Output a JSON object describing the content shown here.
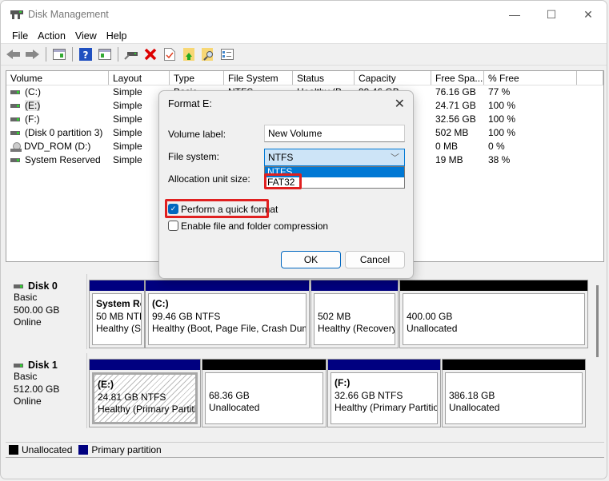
{
  "window": {
    "title": "Disk Management",
    "controls": {
      "minimize": "—",
      "maximize": "☐",
      "close": "✕"
    }
  },
  "menu": [
    "File",
    "Action",
    "View",
    "Help"
  ],
  "toolbar": [
    {
      "icon": "back-arrow-icon"
    },
    {
      "icon": "forward-arrow-icon"
    },
    {
      "icon": "show-hide-console-tree-icon"
    },
    {
      "icon": "help-icon"
    },
    {
      "icon": "show-hide-action-pane-icon"
    },
    {
      "icon": "connect-virtual-disk-icon"
    },
    {
      "icon": "delete-icon"
    },
    {
      "icon": "properties-icon"
    },
    {
      "icon": "export-list-icon"
    },
    {
      "icon": "search-icon"
    },
    {
      "icon": "settings-list-icon"
    }
  ],
  "volume_table": {
    "columns": [
      "Volume",
      "Layout",
      "Type",
      "File System",
      "Status",
      "Capacity",
      "Free Spa...",
      "% Free"
    ],
    "rows": [
      {
        "volume": "(C:)",
        "layout": "Simple",
        "type": "Basic",
        "fs": "NTFS",
        "status": "Healthy (B...",
        "capacity": "99.46 GB",
        "free": "76.16 GB",
        "pct": "77 %",
        "icon": "drive"
      },
      {
        "volume": "(E:)",
        "layout": "Simple",
        "type": "",
        "fs": "",
        "status": "",
        "capacity": "",
        "free": "24.71 GB",
        "pct": "100 %",
        "icon": "drive"
      },
      {
        "volume": "(F:)",
        "layout": "Simple",
        "type": "",
        "fs": "",
        "status": "",
        "capacity": "",
        "free": "32.56 GB",
        "pct": "100 %",
        "icon": "drive"
      },
      {
        "volume": "(Disk 0 partition 3)",
        "layout": "Simple",
        "type": "",
        "fs": "",
        "status": "",
        "capacity": "",
        "free": "502 MB",
        "pct": "100 %",
        "icon": "drive"
      },
      {
        "volume": "DVD_ROM (D:)",
        "layout": "Simple",
        "type": "",
        "fs": "",
        "status": "",
        "capacity": "",
        "free": "0 MB",
        "pct": "0 %",
        "icon": "dvd"
      },
      {
        "volume": "System Reserved",
        "layout": "Simple",
        "type": "",
        "fs": "",
        "status": "",
        "capacity": "",
        "free": "19 MB",
        "pct": "38 %",
        "icon": "drive"
      }
    ]
  },
  "disks": [
    {
      "name": "Disk 0",
      "type": "Basic",
      "size": "500.00 GB",
      "status": "Online",
      "partitions": [
        {
          "l1": "System Re",
          "l2": "50 MB NTF",
          "l3": "Healthy (S",
          "kind": "primary"
        },
        {
          "l1": "(C:)",
          "l2": "99.46 GB NTFS",
          "l3": "Healthy (Boot, Page File, Crash Dum",
          "kind": "primary"
        },
        {
          "l1": "",
          "l2": "502 MB",
          "l3": "Healthy (Recovery",
          "kind": "primary"
        },
        {
          "l1": "",
          "l2": "400.00 GB",
          "l3": "Unallocated",
          "kind": "unallocated"
        }
      ]
    },
    {
      "name": "Disk 1",
      "type": "Basic",
      "size": "512.00 GB",
      "status": "Online",
      "partitions": [
        {
          "l1": "(E:)",
          "l2": "24.81 GB NTFS",
          "l3": "Healthy (Primary Partitio",
          "kind": "primary",
          "selected": true
        },
        {
          "l1": "",
          "l2": "68.36 GB",
          "l3": "Unallocated",
          "kind": "unallocated"
        },
        {
          "l1": "(F:)",
          "l2": "32.66 GB NTFS",
          "l3": "Healthy (Primary Partitio",
          "kind": "primary"
        },
        {
          "l1": "",
          "l2": "386.18 GB",
          "l3": "Unallocated",
          "kind": "unallocated"
        }
      ]
    }
  ],
  "legend": [
    {
      "label": "Unallocated",
      "color": "#000000"
    },
    {
      "label": "Primary partition",
      "color": "#000080"
    }
  ],
  "colors": {
    "primary": "#000080",
    "unallocated": "#000000",
    "accent": "#0078d4",
    "highlight_box": "#e02020"
  },
  "dialog": {
    "title": "Format E:",
    "close": "✕",
    "volume_label_label": "Volume label:",
    "volume_label_value": "New Volume",
    "file_system_label": "File system:",
    "file_system_value": "NTFS",
    "file_system_options": [
      "NTFS",
      "FAT32"
    ],
    "allocation_label": "Allocation unit size:",
    "quick_format_label": "Perform a quick format",
    "quick_format_checked": true,
    "compression_label": "Enable file and folder compression",
    "compression_checked": false,
    "ok_label": "OK",
    "cancel_label": "Cancel"
  }
}
